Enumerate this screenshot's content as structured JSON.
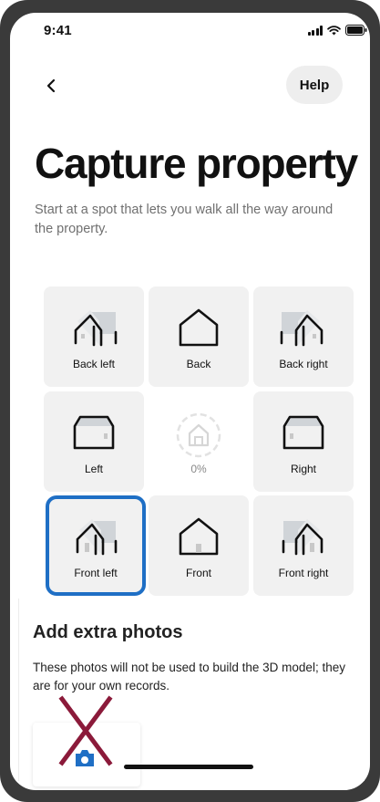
{
  "status_bar": {
    "time": "9:41"
  },
  "nav": {
    "help_label": "Help"
  },
  "header": {
    "title": "Capture property",
    "subtitle": "Start at a spot that lets you walk all the way around the property."
  },
  "grid": {
    "back_left": "Back left",
    "back": "Back",
    "back_right": "Back right",
    "left": "Left",
    "progress": "0%",
    "right": "Right",
    "front_left": "Front left",
    "front": "Front",
    "front_right": "Front right",
    "selected": "Front left"
  },
  "extra": {
    "title": "Add extra photos",
    "description": "These photos will not be used to build the 3D model; they are for your own records."
  },
  "colors": {
    "accent": "#1f6fc5",
    "tile_bg": "#f1f1f1",
    "x_mark": "#8b1a3a"
  }
}
